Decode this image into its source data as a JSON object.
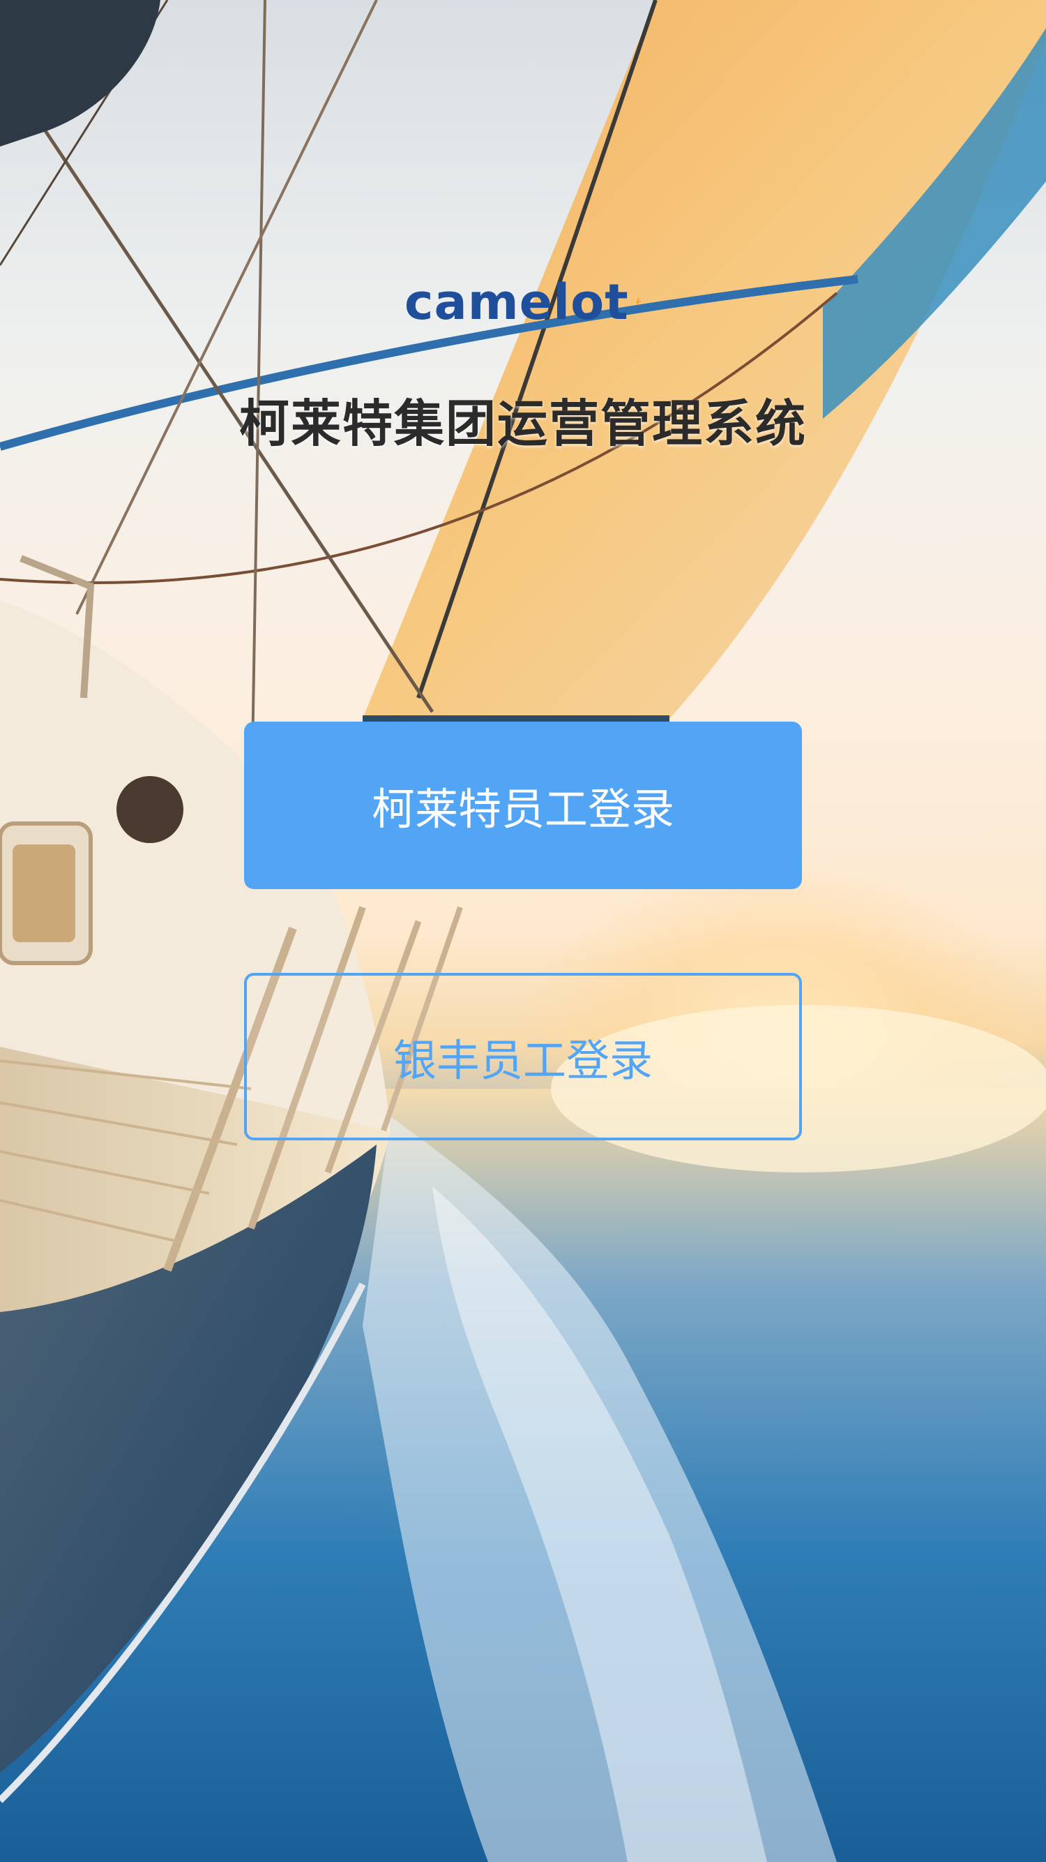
{
  "app": {
    "logo_text": "camelot",
    "title": "柯莱特集团运营管理系统"
  },
  "login": {
    "primary_label": "柯莱特员工登录",
    "secondary_label": "银丰员工登录"
  },
  "colors": {
    "accent": "#52a5f5",
    "logo_blue": "#1f4f9a",
    "logo_orange": "#f08a1c"
  }
}
